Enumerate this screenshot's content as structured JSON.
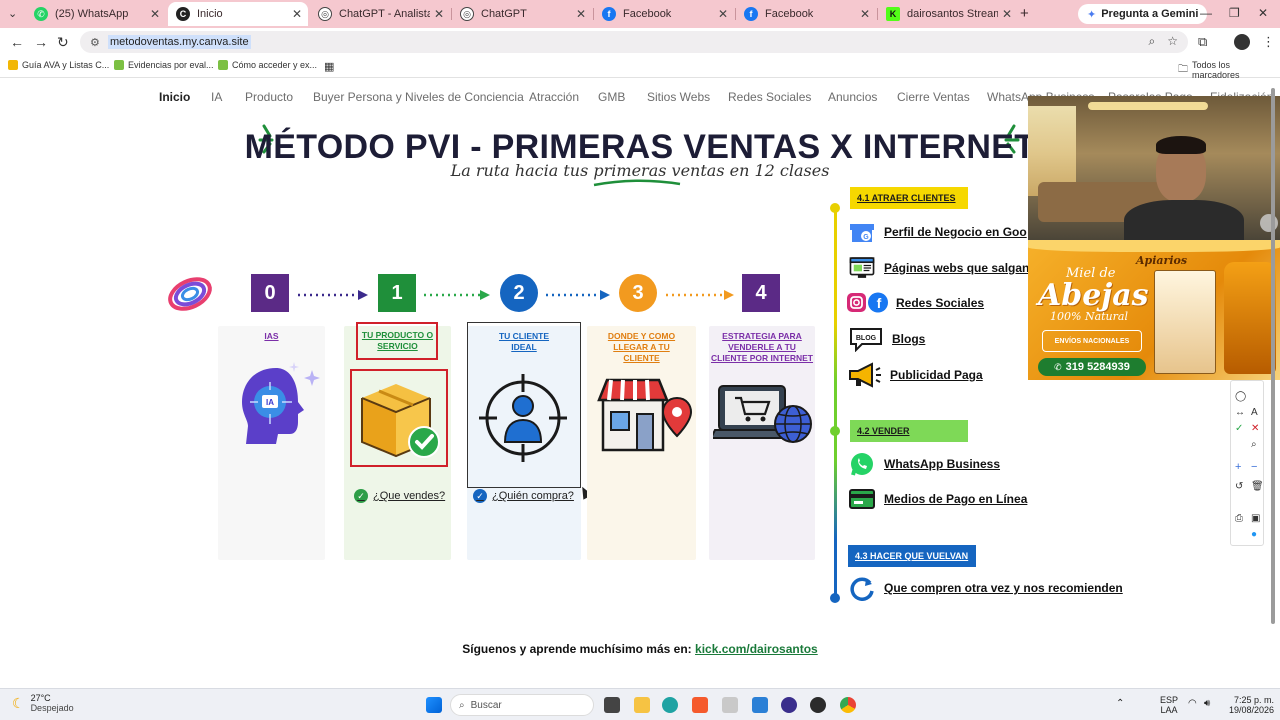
{
  "browser": {
    "tabs": [
      {
        "title": "(25) WhatsApp",
        "icon": "whatsapp-icon",
        "color": "#25d366"
      },
      {
        "title": "Inicio",
        "icon": "canva-icon",
        "color": "#222222",
        "active": true
      },
      {
        "title": "ChatGPT - Analista de Proc",
        "icon": "chatgpt-icon",
        "color": "#444444"
      },
      {
        "title": "ChatGPT",
        "icon": "chatgpt-icon",
        "color": "#444444"
      },
      {
        "title": "Facebook",
        "icon": "facebook-icon",
        "color": "#1877f2"
      },
      {
        "title": "Facebook",
        "icon": "facebook-icon",
        "color": "#1877f2"
      },
      {
        "title": "dairosantos Stream - Watc",
        "icon": "kick-icon",
        "color": "#53fc18"
      }
    ],
    "gemini_label": "Pregunta a Gemini",
    "url": "metodoventas.my.canva.site",
    "bookmarks": [
      {
        "label": "Guía AVA y Listas C...",
        "color": "#f2b705"
      },
      {
        "label": "Evidencias por eval...",
        "color": "#7cc043"
      },
      {
        "label": "Cómo acceder y ex...",
        "color": "#7cc043"
      }
    ],
    "bookmarks_right": "Todos los marcadores"
  },
  "site": {
    "nav": [
      "Inicio",
      "IA",
      "Producto",
      "Buyer Persona y Niveles de Conciencia",
      "Atracción",
      "GMB",
      "Sitios Webs",
      "Redes Sociales",
      "Anuncios",
      "Cierre Ventas",
      "WhatsApp Business",
      "Pasarelas Pago",
      "Fidelización"
    ],
    "title": "MÉTODO PVI - PRIMERAS VENTAS X INTERNET",
    "subtitle": "La ruta hacia tus primeras ventas en 12 clases",
    "steps": [
      {
        "num": "0",
        "color": "#5b2a86",
        "shape": "square",
        "label": "IAS",
        "label_color": "#7b2fa8",
        "card_bg": "#f7f7f7"
      },
      {
        "num": "1",
        "color": "#1f8f3a",
        "shape": "square",
        "label": "TU PRODUCTO O SERVICIO",
        "label_color": "#1f8f3a",
        "card_bg": "#eef6e8",
        "check": "¿Que vendes?",
        "check_color": "#2e9e48"
      },
      {
        "num": "2",
        "color": "#1565c0",
        "shape": "circle",
        "label": "TU CLIENTE IDEAL",
        "label_color": "#1565c0",
        "card_bg": "#eef4fa",
        "check": "¿Quién compra?",
        "check_color": "#1565c0"
      },
      {
        "num": "3",
        "color": "#f29a1f",
        "shape": "circle",
        "label": "DONDE Y COMO LLEGAR A TU CLIENTE",
        "label_color": "#e07e10",
        "card_bg": "#fbf6ea"
      },
      {
        "num": "4",
        "color": "#5b2a86",
        "shape": "square",
        "label": "ESTRATEGIA PARA VENDERLE A TU CLIENTE POR INTERNET",
        "label_color": "#7b2fa8",
        "card_bg": "#f3f0f6"
      }
    ],
    "sections": [
      {
        "tag": "4.1 ATRAER CLIENTES",
        "bg": "#f6d800",
        "fg": "#1a1a1a",
        "items": [
          "Perfil de Negocio en Goo",
          "Páginas webs que salgan",
          "Redes Sociales",
          "Blogs",
          "Publicidad Paga"
        ]
      },
      {
        "tag": "4.2 VENDER",
        "bg": "#7ed957",
        "fg": "#1a1a1a",
        "items": [
          "WhatsApp Business",
          "Medios de Pago en Línea"
        ]
      },
      {
        "tag": "4.3 HACER QUE VUELVAN",
        "bg": "#1565c0",
        "fg": "#ffffff",
        "items": [
          "Que compren otra vez y nos recomienden"
        ]
      }
    ],
    "footer_text": "Síguenos y aprende muchísimo más en:",
    "footer_link": "kick.com/dairosantos"
  },
  "overlay_ad": {
    "brand": "Apiarios",
    "headline_1": "Miel de",
    "headline_2": "Abejas",
    "tagline": "100% Natural",
    "shipping": "ENVÍOS NACIONALES",
    "phone": "319 5284939"
  },
  "taskbar": {
    "temp": "27°C",
    "weather": "Despejado",
    "search_placeholder": "Buscar",
    "lang_1": "ESP",
    "lang_2": "LAA",
    "time": "7:25 p. m.",
    "date": "19/08/2026"
  }
}
